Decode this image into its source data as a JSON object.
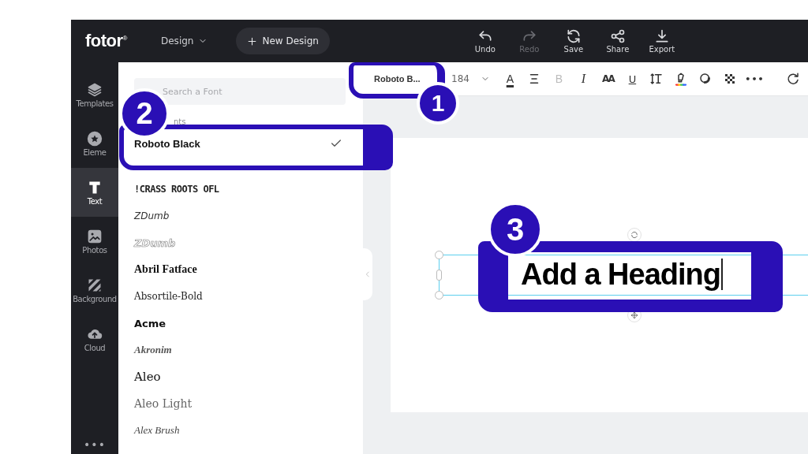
{
  "top_bar": {
    "logo": "fotor$^{®}$",
    "menu": {
      "label": "Design"
    },
    "new_button": {
      "label": "New Design"
    },
    "actions": [
      {
        "kind": "undo",
        "label": "Undo",
        "disabled": false
      },
      {
        "kind": "redo",
        "label": "Redo",
        "disabled": true
      },
      {
        "kind": "save",
        "label": "Save",
        "disabled": false
      },
      {
        "kind": "share",
        "label": "Share",
        "disabled": false
      },
      {
        "kind": "export",
        "label": "Export",
        "disabled": false
      }
    ]
  },
  "sidebar": {
    "items": [
      {
        "kind": "templates",
        "label": "Templates",
        "selected": false
      },
      {
        "kind": "elements",
        "label": "Eleme",
        "selected": false
      },
      {
        "kind": "text",
        "label": "Text",
        "selected": true
      },
      {
        "kind": "photos",
        "label": "Photos",
        "selected": false
      },
      {
        "kind": "background",
        "label": "Background",
        "selected": false
      },
      {
        "kind": "cloud",
        "label": "Cloud",
        "selected": false
      }
    ],
    "more": "•••"
  },
  "font_panel": {
    "search": {
      "placeholder": "Search a Font"
    },
    "section_label": "nts",
    "recent": [
      {
        "name": "Roboto Black",
        "selected": true
      }
    ],
    "fonts": [
      {
        "name": "!CRASS ROOTS OFL",
        "selected": false
      },
      {
        "name": "ZDumb",
        "selected": false
      },
      {
        "name": "ZDumb",
        "selected": false
      },
      {
        "name": "Abril Fatface",
        "selected": false
      },
      {
        "name": "Absortile-Bold",
        "selected": false
      },
      {
        "name": "Acme",
        "selected": false
      },
      {
        "name": "Akronim",
        "selected": false
      },
      {
        "name": "Aleo",
        "selected": false
      },
      {
        "name": "Aleo Light",
        "selected": false
      },
      {
        "name": "Alex Brush",
        "selected": false
      }
    ]
  },
  "toolbar": {
    "font": "Roboto B...",
    "size": "184",
    "tools": [
      {
        "kind": "color",
        "label": "A",
        "disabled": false
      },
      {
        "kind": "align",
        "disabled": false
      },
      {
        "kind": "bold",
        "label": "B",
        "disabled": true
      },
      {
        "kind": "italic",
        "label": "I",
        "disabled": false
      },
      {
        "kind": "case",
        "label": "AA",
        "disabled": false
      },
      {
        "kind": "underline",
        "label": "U",
        "disabled": false
      },
      {
        "kind": "spacing",
        "disabled": false
      },
      {
        "kind": "highlight",
        "disabled": false
      },
      {
        "kind": "effect",
        "disabled": false
      },
      {
        "kind": "transparency",
        "disabled": false
      },
      {
        "kind": "more",
        "label": "•••",
        "disabled": false
      },
      {
        "kind": "refresh",
        "disabled": false
      }
    ]
  },
  "canvas": {
    "heading": "Add a Heading"
  },
  "annotations": [
    {
      "number": "1"
    },
    {
      "number": "2"
    },
    {
      "number": "3"
    }
  ]
}
